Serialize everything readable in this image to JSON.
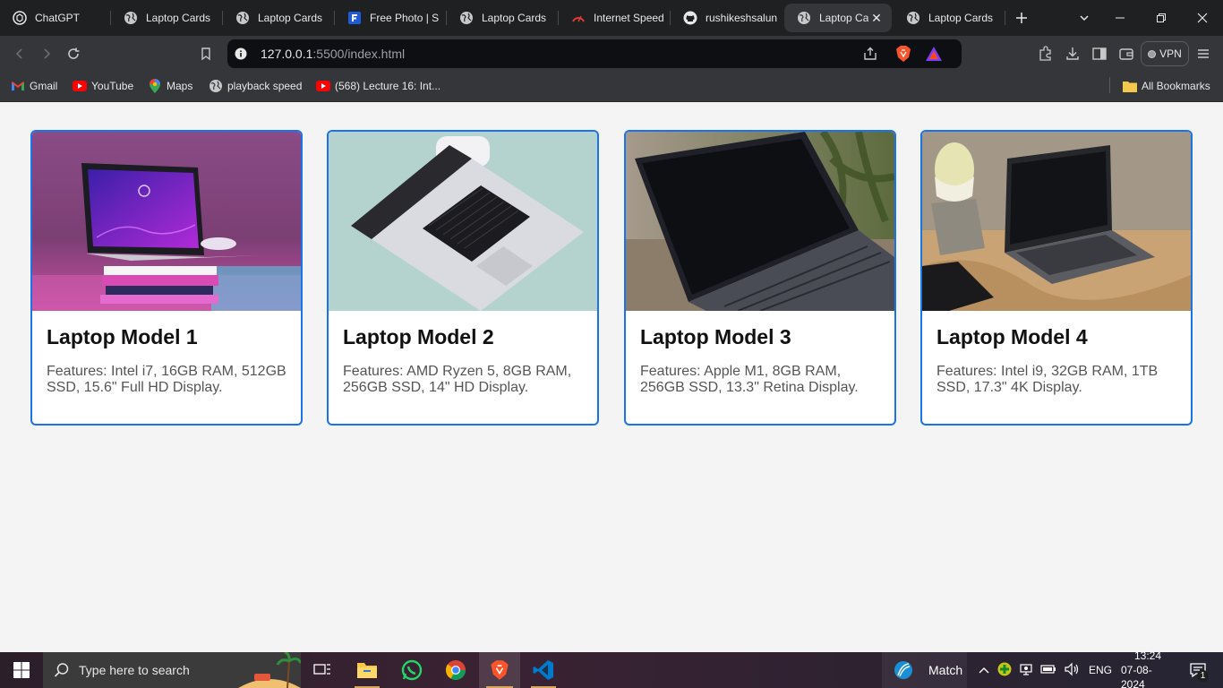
{
  "browser": {
    "tabs": [
      {
        "title": "ChatGPT",
        "icon": "chatgpt-icon"
      },
      {
        "title": "Laptop Cards",
        "icon": "globe-icon"
      },
      {
        "title": "Laptop Cards",
        "icon": "globe-icon"
      },
      {
        "title": "Free Photo | S",
        "icon": "freepik-icon"
      },
      {
        "title": "Laptop Cards",
        "icon": "globe-icon"
      },
      {
        "title": "Internet Speed",
        "icon": "speedtest-icon"
      },
      {
        "title": "rushikeshsalun",
        "icon": "github-icon"
      },
      {
        "title": "Laptop Ca",
        "icon": "globe-icon",
        "active": true
      },
      {
        "title": "Laptop Cards",
        "icon": "globe-icon"
      }
    ],
    "url_host": "127.0.0.1",
    "url_rest": ":5500/index.html",
    "vpn_label": "VPN",
    "bookmarks": [
      {
        "label": "Gmail",
        "icon": "gmail-icon"
      },
      {
        "label": "YouTube",
        "icon": "youtube-icon"
      },
      {
        "label": "Maps",
        "icon": "maps-icon"
      },
      {
        "label": "playback speed",
        "icon": "globe-icon"
      },
      {
        "label": "(568) Lecture 16: Int...",
        "icon": "youtube-icon"
      }
    ],
    "all_bookmarks": "All Bookmarks"
  },
  "cards": [
    {
      "title": "Laptop Model 1",
      "features": "Features: Intel i7, 16GB RAM, 512GB SSD, 15.6\" Full HD Display."
    },
    {
      "title": "Laptop Model 2",
      "features": "Features: AMD Ryzen 5, 8GB RAM, 256GB SSD, 14\" HD Display."
    },
    {
      "title": "Laptop Model 3",
      "features": "Features: Apple M1, 8GB RAM, 256GB SSD, 13.3\" Retina Display."
    },
    {
      "title": "Laptop Model 4",
      "features": "Features: Intel i9, 32GB RAM, 1TB SSD, 17.3\" 4K Display."
    }
  ],
  "taskbar": {
    "search_placeholder": "Type here to search",
    "weather_label": "Match",
    "language": "ENG",
    "time": "13:24",
    "date": "07-08-2024",
    "notification_count": "1"
  },
  "colors": {
    "card_border": "#1a73e8",
    "page_bg": "#f4f4f4"
  }
}
